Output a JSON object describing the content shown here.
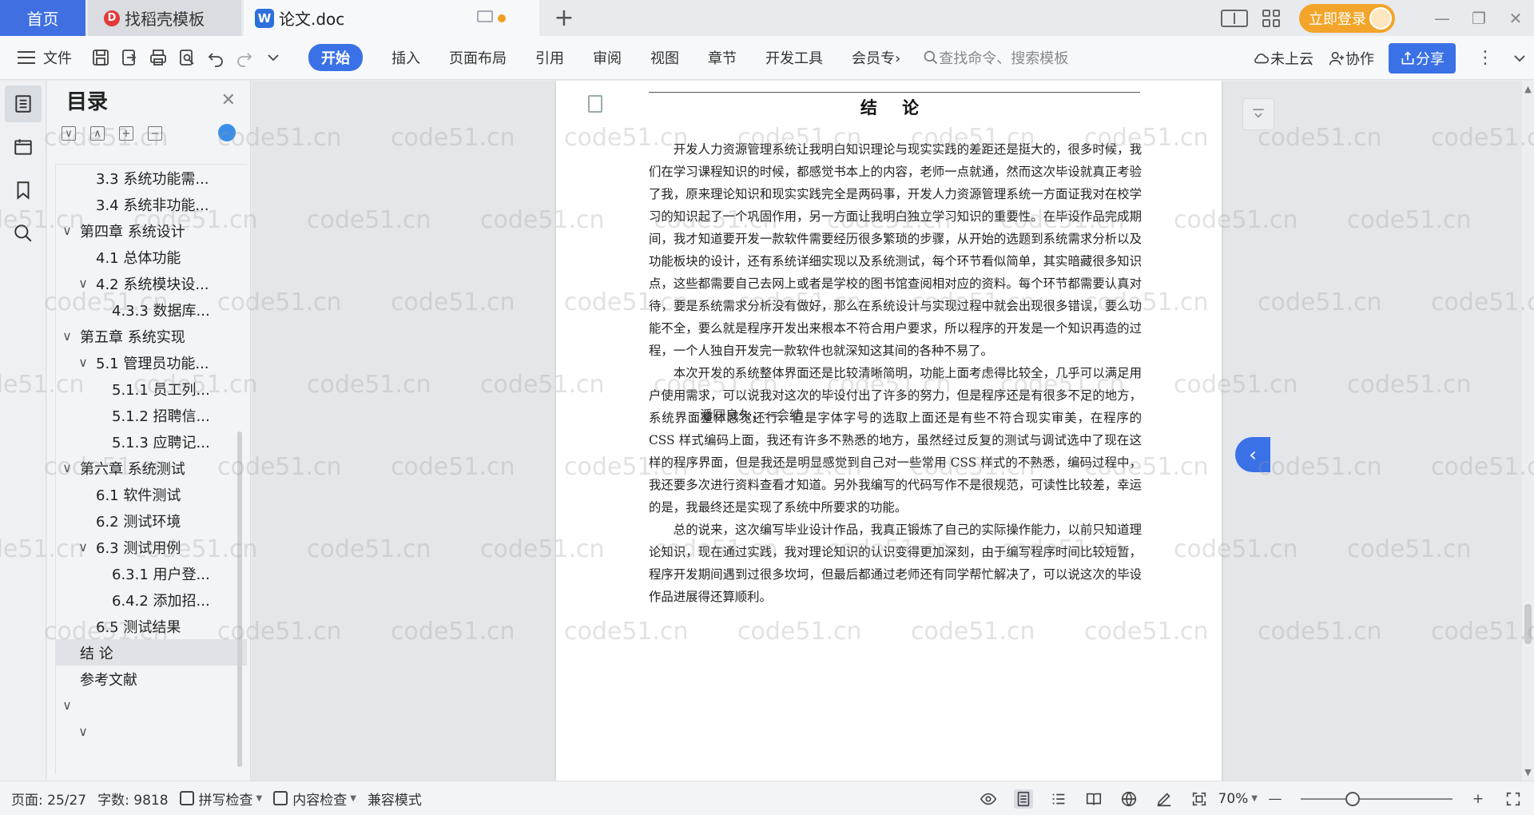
{
  "tabs": {
    "home": "首页",
    "templates": "找稻壳模板",
    "templates_logo": "D",
    "doc": "论文.doc",
    "doc_logo": "W",
    "new_tab": "+"
  },
  "window": {
    "login": "立即登录",
    "minimize": "—",
    "restore": "❐",
    "close": "✕"
  },
  "toolbar": {
    "file": "文件",
    "menus": [
      "开始",
      "插入",
      "页面布局",
      "引用",
      "审阅",
      "视图",
      "章节",
      "开发工具",
      "会员专"
    ],
    "active_menu": "开始",
    "more": "›",
    "search_placeholder": "查找命令、搜索模板",
    "cloud": "未上云",
    "collab": "协作",
    "share": "分享",
    "more_dots": "⋮"
  },
  "outline": {
    "title": "目录",
    "items": [
      {
        "level": 2,
        "chev": "",
        "label": "3.3 系统功能需..."
      },
      {
        "level": 2,
        "chev": "",
        "label": "3.4 系统非功能..."
      },
      {
        "level": 1,
        "chev": "∨",
        "label": "第四章 系统设计"
      },
      {
        "level": 2,
        "chev": "",
        "label": "4.1 总体功能"
      },
      {
        "level": 2,
        "chev": "∨",
        "label": "4.2 系统模块设..."
      },
      {
        "level": 3,
        "chev": "",
        "label": "4.3.3 数据库..."
      },
      {
        "level": 1,
        "chev": "∨",
        "label": "第五章 系统实现"
      },
      {
        "level": 2,
        "chev": "∨",
        "label": "5.1 管理员功能..."
      },
      {
        "level": 3,
        "chev": "",
        "label": "5.1.1 员工列..."
      },
      {
        "level": 3,
        "chev": "",
        "label": "5.1.2 招聘信..."
      },
      {
        "level": 3,
        "chev": "",
        "label": "5.1.3 应聘记..."
      },
      {
        "level": 1,
        "chev": "∨",
        "label": "第六章 系统测试"
      },
      {
        "level": 2,
        "chev": "",
        "label": "6.1 软件测试"
      },
      {
        "level": 2,
        "chev": "",
        "label": "6.2 测试环境"
      },
      {
        "level": 2,
        "chev": "∨",
        "label": "6.3 测试用例"
      },
      {
        "level": 3,
        "chev": "",
        "label": "6.3.1 用户登..."
      },
      {
        "level": 3,
        "chev": "",
        "label": "6.4.2 添加招..."
      },
      {
        "level": 2,
        "chev": "",
        "label": "6.5 测试结果"
      },
      {
        "level": 1,
        "chev": "",
        "label": "结 论",
        "active": true
      },
      {
        "level": 1,
        "chev": "",
        "label": "参考文献"
      },
      {
        "level": 1,
        "chev": "∨",
        "label": ""
      },
      {
        "level": 2,
        "chev": "∨",
        "label": ""
      }
    ]
  },
  "document": {
    "title": "结 论",
    "paragraphs": [
      "开发人力资源管理系统让我明白知识理论与现实实践的差距还是挺大的，很多时候，我们在学习课程知识的时候，都感觉书本上的内容，老师一点就通，然而这次毕设就真正考验了我，原来理论知识和现实实践完全是两码事，开发人力资源管理系统一方面证我对在校学习的知识起了一个巩固作用，另一方面让我明白独立学习知识的重要性。在毕设作品完成期间，我才知道要开发一款软件需要经历很多繁琐的步骤，从开始的选题到系统需求分析以及功能板块的设计，还有系统详细实现以及系统测试，每个环节看似简单，其实暗藏很多知识点，这些都需要自己去网上或者是学校的图书馆查阅相对应的资料。每个环节都需要认真对待，要是系统需求分析没有做好，那么在系统设计与实现过程中就会出现很多错误，要么功能不全，要么就是程序开发出来根本不符合用户要求，所以程序的开发是一个知识再造的过程，一个人独自开发完一款软件也就深知这其间的各种不易了。",
      "本次开发的系统整体界面还是比较清晰简明，功能上面考虑得比较全，几乎可以满足用户使用需求，可以说我对这次的毕设付出了许多的努力，但是程序还是有很多不足的地方，系统界面整体感觉还行，但是字体字号的选取上面还是有些不符合现实审美，在程序的 CSS 样式编码上面，我还有许多不熟悉的地方，虽然经过反复的测试与调试选中了现在这样的程序界面，但是我还是明显感觉到自己对一些常用 CSS 样式的不熟悉，编码过程中，我还要多次进行资料查看才知道。另外我编写的代码写作不是很规范，可读性比较差，幸运的是，我最终还是实现了系统中所要求的功能。",
      "总的说来，这次编写毕业设计作品，我真正锻炼了自己的实际操作能力，以前只知道理论知识，现在通过实践，我对理论知识的认识变得更加深刻，由于编写程序时间比较短暂，程序开发期间遇到过很多坎坷，但最后都通过老师还有同学帮忙解决了，可以说这次的毕设作品进展得还算顺利。"
    ],
    "overlay": "潘同良久，一会结"
  },
  "watermark": "code51.cn",
  "status": {
    "page": "页面: 25/27",
    "words": "字数: 9818",
    "spell": "拼写检查",
    "content": "内容检查",
    "compat": "兼容模式",
    "zoom": "70%",
    "zoom_minus": "—",
    "zoom_plus": "+"
  }
}
